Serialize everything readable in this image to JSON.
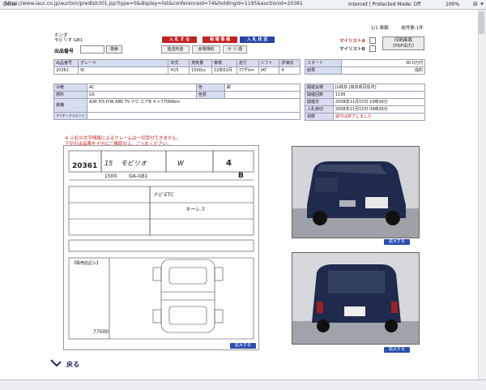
{
  "browser": {
    "url": "https://www.iauc.co.jp/auction/predtslct01.jsp?type=0&display=list&conferenceid=74&holdingid=1195&auctionid=20361",
    "status": "Done",
    "zone": "Internet | Protected Mode: Off",
    "zoom": "100%"
  },
  "pager": {
    "page": "1/1 車輌",
    "count": "総件数:1件"
  },
  "vehicle": {
    "maker": "ホンダ",
    "model": "モビリオ GB1"
  },
  "bid": {
    "label": "出品番号",
    "search_label": "検索"
  },
  "buttons": {
    "bid": "入 札 す る",
    "market": "相 場 情 報",
    "bid_status": "入 札 状 況",
    "shipping": "陸送料金",
    "venue_rules": "会場規約",
    "seri": "セ リ 順"
  },
  "mylist": {
    "a": "マイリストA",
    "b": "マイリストB",
    "print": "印刷画面\n（PDF出力）"
  },
  "table1": {
    "headers": [
      "出品番号",
      "グレード",
      "年式",
      "排気量",
      "車検",
      "走行",
      "シフト",
      "評価点"
    ],
    "values": [
      "20361",
      "W",
      "H15",
      "1500cc",
      "22年02月",
      "77千km",
      "IAT",
      "4"
    ]
  },
  "table2": {
    "rows": [
      {
        "label": "スタート",
        "value": "30.0万円",
        "red": false
      },
      {
        "label": "結果",
        "value": "成約",
        "red": false
      }
    ]
  },
  "table3": {
    "rows": [
      {
        "l1": "冷暖",
        "v1": "AC",
        "l2": "色",
        "v2": "紺"
      },
      {
        "l1": "燃料",
        "v1": "GS",
        "l2": "色替",
        "v2": ""
      },
      {
        "l1": "装備",
        "v1": "A/W P/S P/W ABS TV ナビ エアB キャ77000km",
        "l2": "",
        "v2": ""
      },
      {
        "l1": "アイポークコメント",
        "v1": "",
        "l2": "",
        "v2": ""
      }
    ]
  },
  "table4": {
    "rows": [
      {
        "label": "開催会場",
        "value": "JU岐阜 [岐阜県羽島市]",
        "red": false
      },
      {
        "label": "開催回数",
        "value": "1195",
        "red": false
      },
      {
        "label": "開催日",
        "value": "2008年11月15日 10時36分",
        "red": false
      },
      {
        "label": "入札締切",
        "value": "2008年11月15日 09時36分",
        "red": false
      },
      {
        "label": "状態",
        "value": "受付は終了しました",
        "red": true
      }
    ]
  },
  "notice": {
    "line1": "※ 上記の文字情報によるクレームは一切受付できません。",
    "line2": "下記の出品票を十分にご確認の上、ご入札ください。"
  },
  "sheet": {
    "lot": "20361",
    "year": "15",
    "model": "モビリオ",
    "grade": "W",
    "cc": "1500",
    "type": "GA-GB1",
    "score": "4",
    "interior": "B",
    "equip1": "ナビ ETC",
    "equip2": "キーレス",
    "sales_point": "【販売店記入】",
    "distance": "77000"
  },
  "photos": {
    "enlarge": "拡大する"
  },
  "back": {
    "label": "戻る"
  },
  "colors": {
    "red": "#c32222",
    "blue": "#2846a8",
    "car": "#1f2a4d",
    "header_cell": "#d8dcef"
  }
}
